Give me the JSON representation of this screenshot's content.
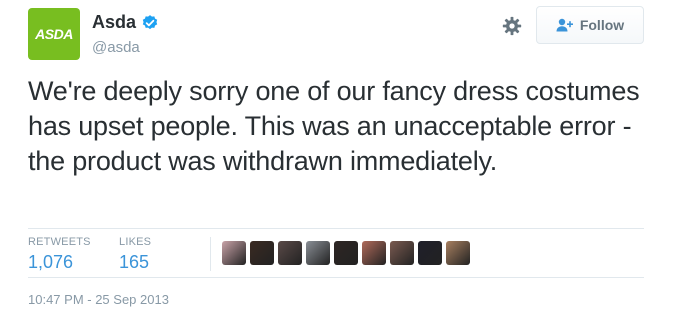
{
  "user": {
    "display_name": "Asda",
    "handle": "@asda",
    "logo_text": "ASDA",
    "verified": true,
    "brand_color": "#78be20"
  },
  "actions": {
    "settings_icon": "gear-icon",
    "follow_label": "Follow",
    "follow_icon": "add-user-icon"
  },
  "tweet": {
    "text": "We're deeply sorry one of our fancy dress costumes has upset people. This was an unacceptable error - the product was withdrawn immediately."
  },
  "stats": {
    "retweets_label": "RETWEETS",
    "retweets_value": "1,076",
    "likes_label": "LIKES",
    "likes_value": "165",
    "liker_avatars": [
      "#c9a3a8",
      "#3a2a22",
      "#5a4a48",
      "#8a8f96",
      "#2e2624",
      "#b06a5a",
      "#7a5a50",
      "#1f1f2a",
      "#a88060"
    ]
  },
  "timestamp": "10:47 PM - 25 Sep 2013",
  "colors": {
    "link_blue": "#3b94d9",
    "verified_blue": "#1da1f2",
    "muted_text": "#8899a6",
    "border": "#e1e8ed"
  }
}
